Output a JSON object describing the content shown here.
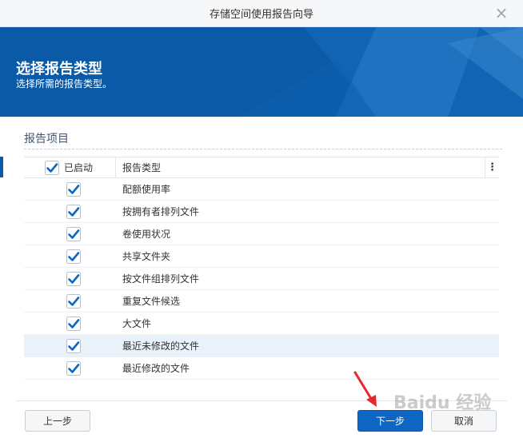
{
  "window": {
    "title": "存储空间使用报告向导",
    "close_icon": "×"
  },
  "banner": {
    "heading": "选择报告类型",
    "subheading": "选择所需的报告类型。",
    "background_color": "#0b5aa8"
  },
  "section": {
    "title": "报告项目"
  },
  "table": {
    "headers": {
      "enabled": "已启动",
      "type": "报告类型",
      "menu": "⋮"
    },
    "header_checked": true,
    "rows": [
      {
        "label": "配额使用率",
        "checked": true
      },
      {
        "label": "按拥有者排列文件",
        "checked": true
      },
      {
        "label": "卷使用状况",
        "checked": true
      },
      {
        "label": "共享文件夹",
        "checked": true
      },
      {
        "label": "按文件组排列文件",
        "checked": true
      },
      {
        "label": "重复文件候选",
        "checked": true
      },
      {
        "label": "大文件",
        "checked": true
      },
      {
        "label": "最近未修改的文件",
        "checked": true,
        "highlighted": true
      },
      {
        "label": "最近修改的文件",
        "checked": true
      }
    ]
  },
  "footer": {
    "prev_label": "上一步",
    "next_label": "下一步",
    "cancel_label": "取消"
  },
  "annotation": {
    "arrow_color": "#e8262b"
  },
  "watermark": {
    "text": "Baidu 经验"
  }
}
